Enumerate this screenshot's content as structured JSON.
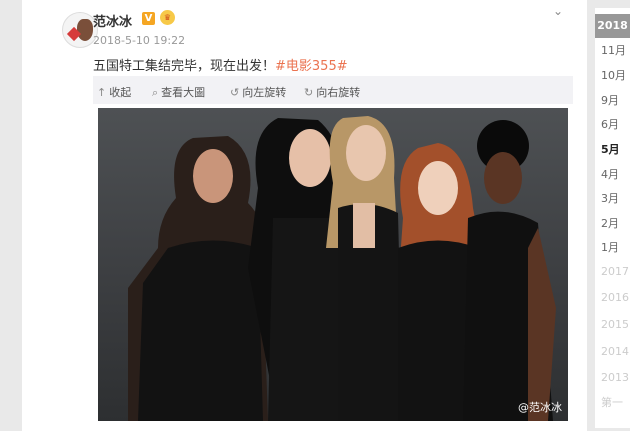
{
  "post": {
    "username": "范冰冰",
    "v_badge": "V",
    "timestamp": "2018-5-10 19:22",
    "text": "五国特工集结完毕，现在出发！",
    "hashtag": "#电影355#"
  },
  "toolbar": {
    "collapse": "收起",
    "view_large": "查看大圖",
    "rotate_left": "向左旋转",
    "rotate_right": "向右旋转"
  },
  "photo": {
    "watermark": "@范冰冰"
  },
  "timeline": {
    "current_year": "2018",
    "months": [
      "11月",
      "10月",
      "9月",
      "6月",
      "5月",
      "4月",
      "3月",
      "2月",
      "1月"
    ],
    "active_month": "5月",
    "years": [
      "2017",
      "2016",
      "2015",
      "2014",
      "2013"
    ],
    "last": "第一"
  },
  "colors": {
    "hashtag": "#eb7350",
    "badge": "#f5a623"
  }
}
